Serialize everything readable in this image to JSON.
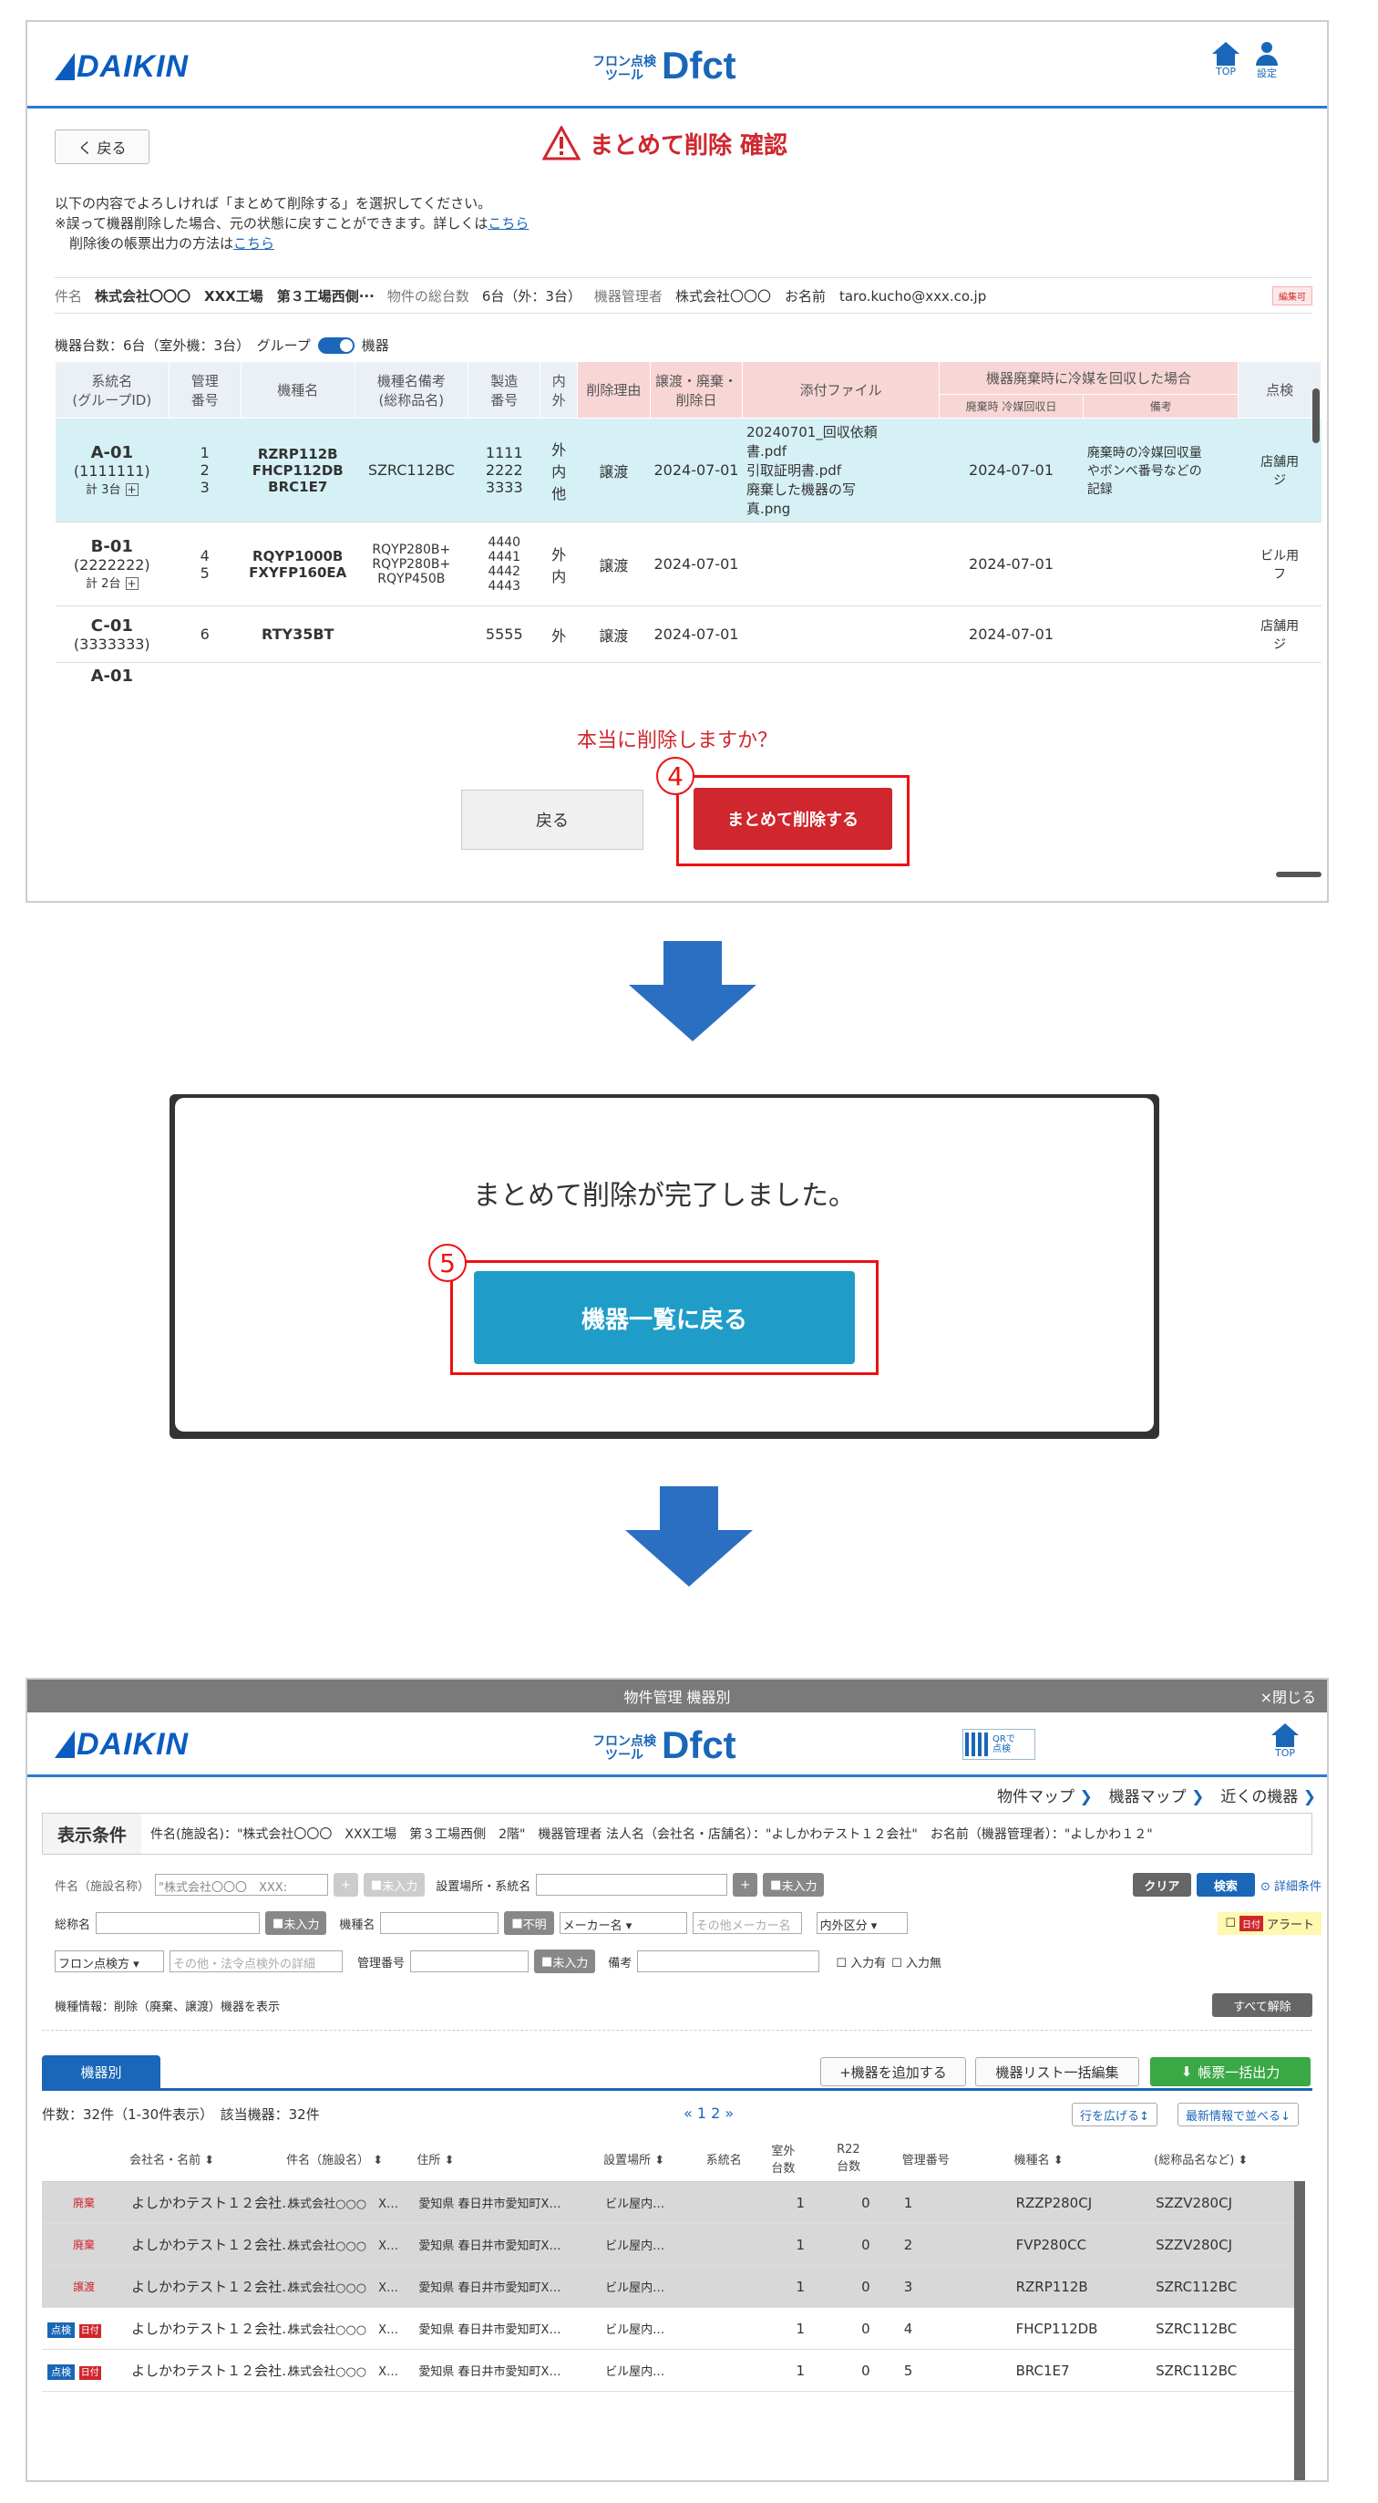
{
  "s1": {
    "logo": "DAIKIN",
    "dfct_small": "フロン点検\nツール",
    "dfct": "Dfct",
    "top": "TOP",
    "settings": "設定",
    "back": "く 戻る",
    "title": "まとめて削除 確認",
    "msg1": "以下の内容でよろしければ「まとめて削除する」を選択してください。",
    "msg2a": "※誤って機器削除した場合、元の状態に戻すことができます。詳しくは",
    "msg2link": "こちら",
    "msg3a": "削除後の帳票出力の方法は",
    "msg3link": "こちら",
    "info": {
      "k1": "件名",
      "v1": "株式会社〇〇〇　XXX工場　第３工場西側···",
      "k2": "物件の総台数",
      "v2": "6台（外：3台）",
      "k3": "機器管理者",
      "v3": "株式会社〇〇〇　お名前　taro.kucho@xxx.co.jp",
      "edit": "編集可"
    },
    "count": "機器台数：6台（室外機：3台）　グループ",
    "toggle_label": "機器",
    "headers": [
      "系統名\n(グループID)",
      "管理\n番号",
      "機種名",
      "機種名備考\n(総称品名)",
      "製造\n番号",
      "内\n外",
      "削除理由",
      "譲渡・廃棄・\n削除日",
      "添付ファイル",
      "機器廃棄時に冷媒を回収した場合",
      "点検"
    ],
    "subheaders": [
      "廃棄時 冷媒回収日",
      "備考"
    ],
    "rows": [
      {
        "sys": "A-01",
        "gid": "(1111111)",
        "total": "計 3台",
        "num": "1\n2\n3",
        "model": "RZRP112B\nFHCP112DB\nBRC1E7",
        "note": "SZRC112BC",
        "serial": "1111\n2222\n3333",
        "io": "外\n内\n他",
        "reason": "譲渡",
        "date": "2024-07-01",
        "file": "20240701_回収依頼\n書.pdf\n引取証明書.pdf\n廃棄した機器の写\n真.png",
        "rdate": "2024-07-01",
        "rnote": "廃棄時の冷媒回収量\nやボンベ番号などの\n記録",
        "insp": "店舗用\nジ"
      },
      {
        "sys": "B-01",
        "gid": "(2222222)",
        "total": "計 2台",
        "num": "4\n5",
        "model": "RQYP1000B\nFXYFP160EA",
        "note": "RQYP280B+\nRQYP280B+\nRQYP450B",
        "serial": "4440\n4441\n4442\n4443",
        "io": "外\n内",
        "reason": "譲渡",
        "date": "2024-07-01",
        "file": "",
        "rdate": "2024-07-01",
        "rnote": "",
        "insp": "ビル用\nフ"
      },
      {
        "sys": "C-01",
        "gid": "(3333333)",
        "total": "",
        "num": "6",
        "model": "RTY35BT",
        "note": "",
        "serial": "5555",
        "io": "外",
        "reason": "譲渡",
        "date": "2024-07-01",
        "file": "",
        "rdate": "2024-07-01",
        "rnote": "",
        "insp": "店舗用\nジ"
      }
    ],
    "partial": "A-01",
    "confirm": "本当に削除しますか？",
    "cancel": "戻る",
    "submit": "まとめて削除する",
    "step": "4"
  },
  "s2": {
    "msg": "まとめて削除が完了しました。",
    "btn": "機器一覧に戻る",
    "step": "5"
  },
  "s3": {
    "topbar": "物件管理 機器別",
    "close": "×閉じる",
    "logo": "DAIKIN",
    "dfct_small": "フロン点検\nツール",
    "dfct": "Dfct",
    "qr": "QRで\n点検",
    "top": "TOP",
    "nav": [
      "物件マップ",
      "機器マップ",
      "近くの機器"
    ],
    "cond_label": "表示条件",
    "cond_text": "件名(施設名)：\"株式会社〇〇〇　XXX工場　第３工場西側　2階\"　機器管理者 法人名（会社名・店舗名）：\"よしかわテスト１２会社\"　お名前（機器管理者）：\"よしかわ１２\"",
    "f_name": "件名（施設名称）",
    "f_name_val": "\"株式会社〇〇〇　XXX:",
    "unset": "未入力",
    "f_place": "設置場所・系統名",
    "clear": "クリア",
    "search": "検索",
    "detail": "詳細条件",
    "f_general": "総称名",
    "f_model": "機種名",
    "unknown": "不明",
    "maker": "メーカー名",
    "maker_other": "その他メーカー名",
    "inout": "内外区分",
    "alert": "アラート",
    "freon": "フロン点検方",
    "freon_other": "その他・法令点検外の詳細",
    "f_mgmt": "管理番号",
    "f_memo": "備考",
    "has_input": "入力有",
    "no_input": "入力無",
    "device_info": "機種情報：削除（廃棄、譲渡）機器を表示",
    "clear_all": "すべて解除",
    "tab": "機器別",
    "add": "+機器を追加する",
    "bulk": "機器リスト一括編集",
    "export": "帳票一括出力",
    "count": "件数：32件（1-30件表示）　該当機器：32件",
    "pages": "« 1 2 »",
    "expand": "行を広げる↕",
    "latest": "最新情報で並べる↓",
    "headers": [
      "",
      "会社名・名前",
      "件名（施設名）",
      "住所",
      "設置場所",
      "系統名",
      "室外\n台数",
      "R22\n台数",
      "管理番号",
      "機種名",
      "(総称品名など)"
    ],
    "rows": [
      {
        "status": "廃棄",
        "company": "よしかわテスト１２会社…",
        "name": "株式会社○○○　X…",
        "addr": "愛知県 春日井市愛知町X…",
        "place": "ビル屋内…",
        "out": "1",
        "r22": "0",
        "mgmt": "1",
        "model": "RZZP280CJ",
        "note": "SZZV280CJ"
      },
      {
        "status": "廃棄",
        "company": "よしかわテスト１２会社…",
        "name": "株式会社○○○　X…",
        "addr": "愛知県 春日井市愛知町X…",
        "place": "ビル屋内…",
        "out": "1",
        "r22": "0",
        "mgmt": "2",
        "model": "FVP280CC",
        "note": "SZZV280CJ"
      },
      {
        "status": "譲渡",
        "company": "よしかわテスト１２会社…",
        "name": "株式会社○○○　X…",
        "addr": "愛知県 春日井市愛知町X…",
        "place": "ビル屋内…",
        "out": "1",
        "r22": "0",
        "mgmt": "3",
        "model": "RZRP112B",
        "note": "SZRC112BC"
      },
      {
        "status": "点検",
        "company": "よしかわテスト１２会社…",
        "name": "株式会社○○○　X…",
        "addr": "愛知県 春日井市愛知町X…",
        "place": "ビル屋内…",
        "out": "1",
        "r22": "0",
        "mgmt": "4",
        "model": "FHCP112DB",
        "note": "SZRC112BC"
      },
      {
        "status": "点検",
        "company": "よしかわテスト１２会社…",
        "name": "株式会社○○○　X…",
        "addr": "愛知県 春日井市愛知町X…",
        "place": "ビル屋内…",
        "out": "1",
        "r22": "0",
        "mgmt": "5",
        "model": "BRC1E7",
        "note": "SZRC112BC"
      }
    ],
    "cal": "日付"
  },
  "colors": {
    "daikin": "#0a5cc0",
    "accent": "#1a66b8",
    "red": "#d0262d",
    "cyan": "#1f9dc8",
    "green": "#3aa845"
  }
}
